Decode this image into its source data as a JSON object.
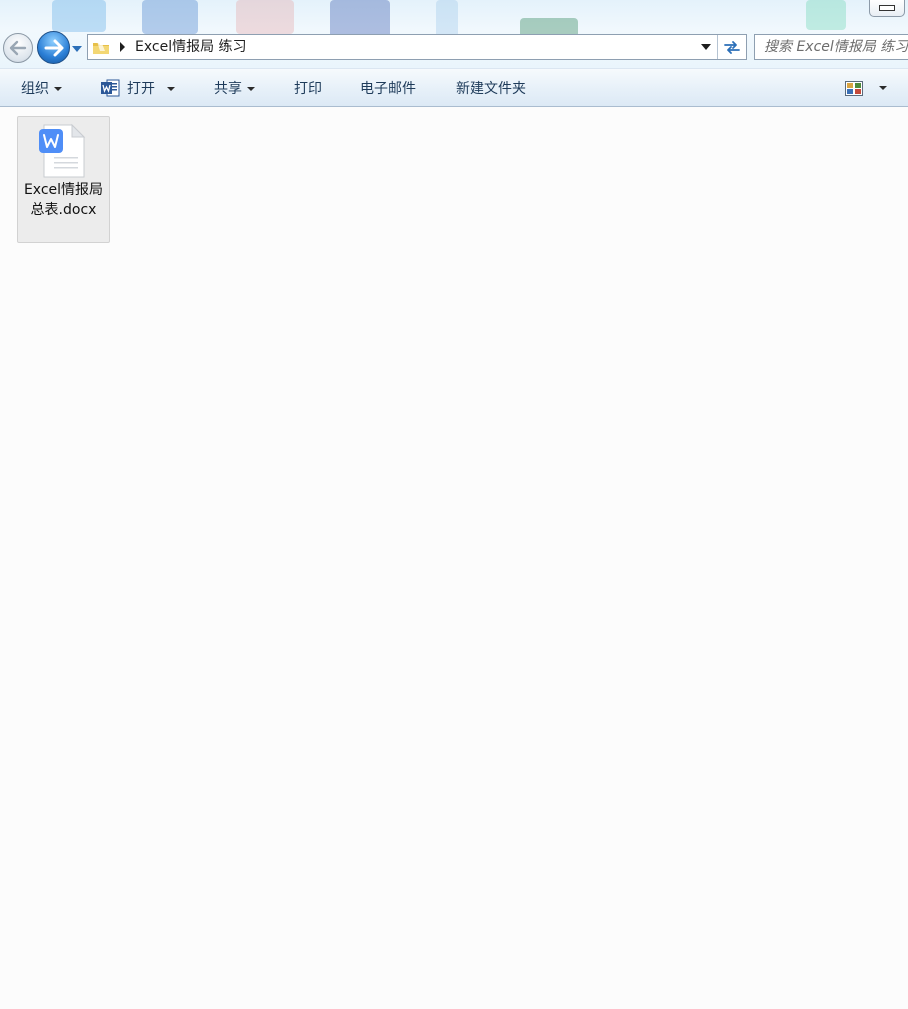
{
  "address_bar": {
    "path": "Excel情报局 练习"
  },
  "search": {
    "placeholder": "搜索 Excel情报局 练习"
  },
  "toolbar": {
    "organize": "组织",
    "open": "打开",
    "share": "共享",
    "print": "打印",
    "email": "电子邮件",
    "new_folder": "新建文件夹"
  },
  "files": [
    {
      "name": "Excel情报局 总表.docx",
      "icon": "wps-word-document-icon"
    }
  ],
  "colors": {
    "accent": "#2b7fd6",
    "word_blue": "#4f8ef7",
    "toolbar_text": "#1e3b5a",
    "selection_bg": "#ececec"
  }
}
